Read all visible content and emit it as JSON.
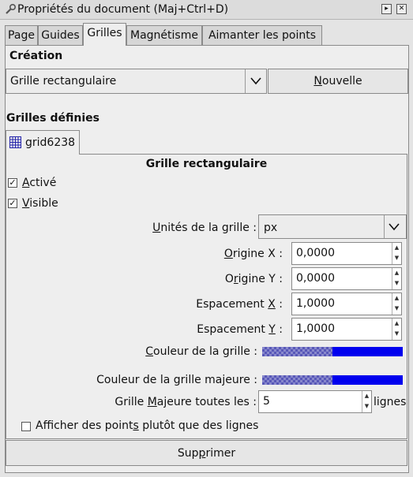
{
  "window": {
    "title": "Propriétés du document (Maj+Ctrl+D)"
  },
  "tabs": [
    {
      "label": "Page"
    },
    {
      "label": "Guides"
    },
    {
      "label": "Grilles"
    },
    {
      "label": "Magnétisme"
    },
    {
      "label": "Aimanter les points"
    }
  ],
  "creation": {
    "heading": "Création",
    "type_value": "Grille rectangulaire",
    "new_button_pre": "",
    "new_button_key": "N",
    "new_button_post": "ouvelle"
  },
  "defined": {
    "heading": "Grilles définies",
    "grid_tab_label": "grid6238",
    "grid_heading": "Grille rectangulaire"
  },
  "options": {
    "enabled_key": "A",
    "enabled_rest": "ctivé",
    "enabled_checked": true,
    "visible_key": "V",
    "visible_rest": "isible",
    "visible_checked": true
  },
  "fields": {
    "units_key": "U",
    "units_rest": "nités de la grille :",
    "units_value": "px",
    "originx_key": "O",
    "originx_rest": "rigine X :",
    "originx_value": "0,0000",
    "originy_pre": "O",
    "originy_key": "r",
    "originy_rest": "igine Y :",
    "originy_value": "0,0000",
    "spacingx_pre": "Espacement ",
    "spacingx_key": "X",
    "spacingx_rest": " :",
    "spacingx_value": "1,0000",
    "spacingy_pre": "Espacement ",
    "spacingy_key": "Y",
    "spacingy_rest": " :",
    "spacingy_value": "1,0000",
    "color_key": "C",
    "color_rest": "ouleur de la grille :",
    "major_color_label": "Couleur de la grille majeure :",
    "major_every_pre": "Grille ",
    "major_every_key": "M",
    "major_every_rest": "ajeure toutes les :",
    "major_every_value": "5",
    "major_every_unit": "lignes",
    "dots_pre": "Afficher des point",
    "dots_key": "s",
    "dots_rest": " plutôt que des lignes",
    "dots_checked": false
  },
  "colors": {
    "grid_color": "#0000ee",
    "major_grid_color": "#0000ee"
  },
  "footer": {
    "delete_pre": "Sup",
    "delete_key": "p",
    "delete_rest": "rimer"
  }
}
